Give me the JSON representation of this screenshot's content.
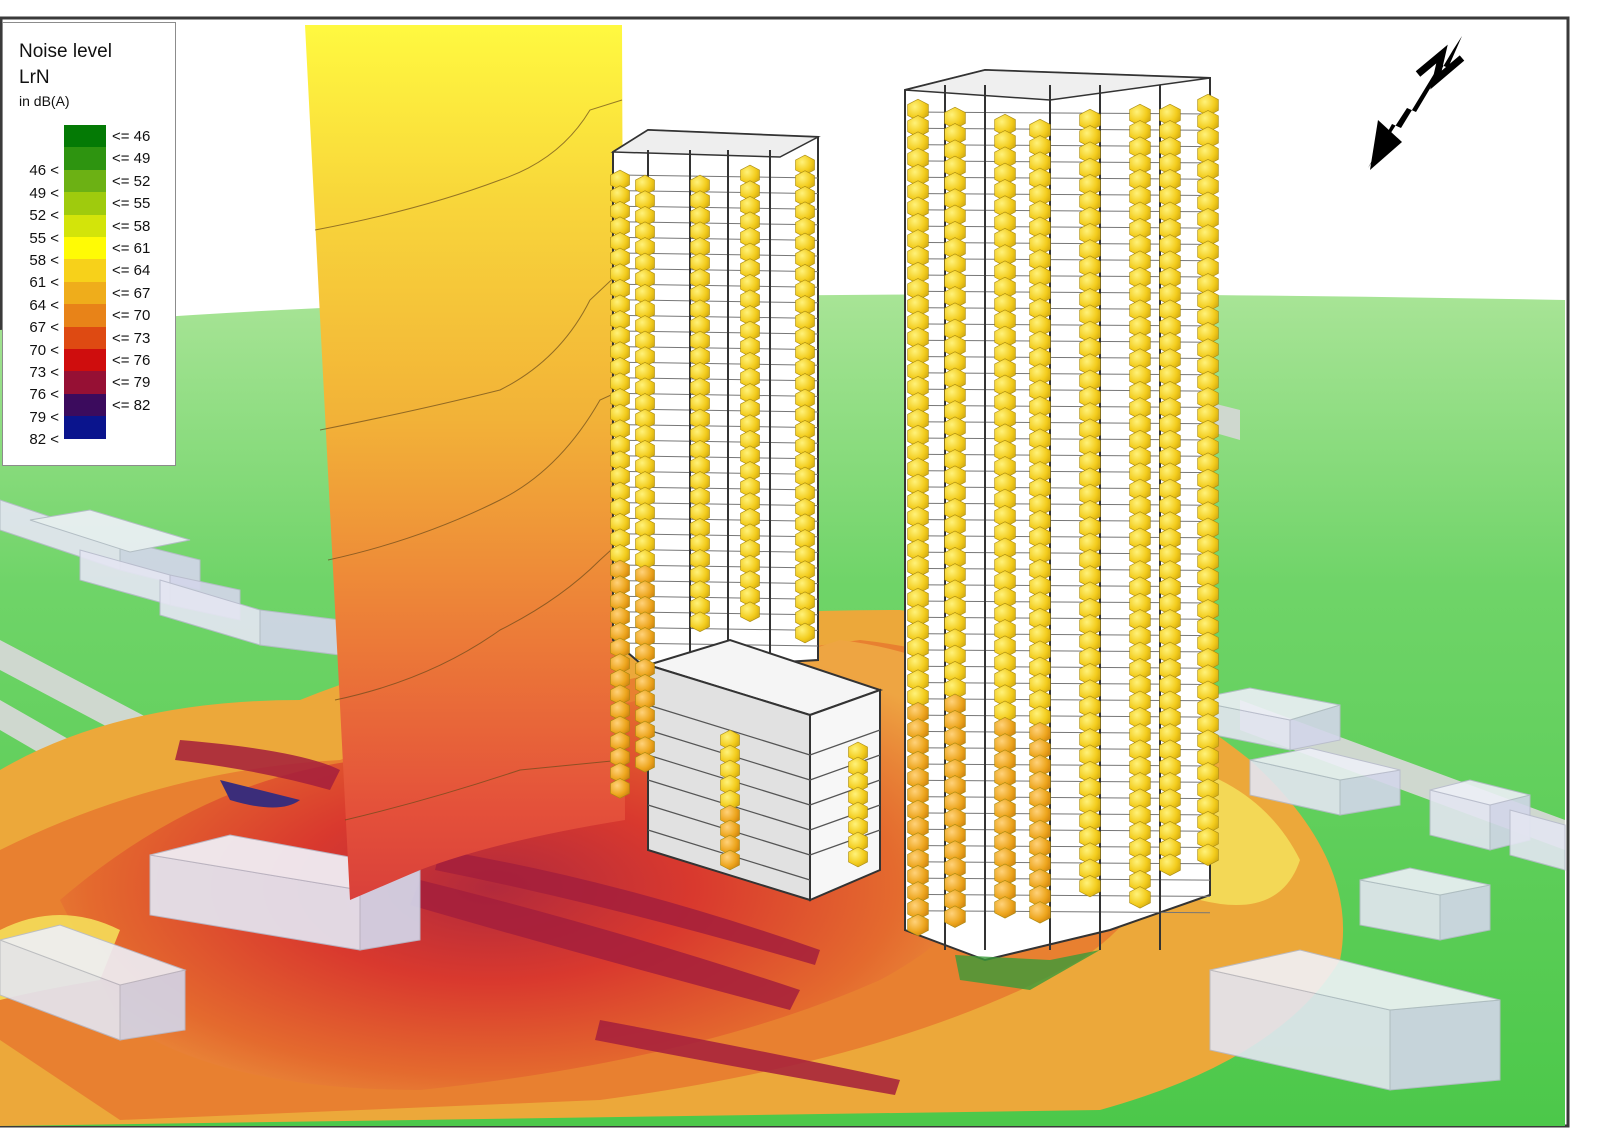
{
  "legend": {
    "title_line1": "Noise level",
    "title_line2": "LrN",
    "unit": "in dB(A)",
    "classes": [
      {
        "low": "",
        "high": "<= 46",
        "color": "#047a05"
      },
      {
        "low": "46 <",
        "high": "<= 49",
        "color": "#2e9410"
      },
      {
        "low": "49 <",
        "high": "<= 52",
        "color": "#6cb114"
      },
      {
        "low": "52 <",
        "high": "<= 55",
        "color": "#9fcb0d"
      },
      {
        "low": "55 <",
        "high": "<= 58",
        "color": "#d3e40a"
      },
      {
        "low": "58 <",
        "high": "<= 61",
        "color": "#fffb05"
      },
      {
        "low": "61 <",
        "high": "<= 64",
        "color": "#f7d11a"
      },
      {
        "low": "64 <",
        "high": "<= 67",
        "color": "#efad1b"
      },
      {
        "low": "67 <",
        "high": "<= 70",
        "color": "#e88318"
      },
      {
        "low": "70 <",
        "high": "<= 73",
        "color": "#de4a12"
      },
      {
        "low": "73 <",
        "high": "<= 76",
        "color": "#cf0d0d"
      },
      {
        "low": "76 <",
        "high": "<= 79",
        "color": "#961034"
      },
      {
        "low": "79 <",
        "high": "<= 82",
        "color": "#3b0b5d"
      },
      {
        "low": "82 <",
        "high": "",
        "color": "#0a148d"
      }
    ]
  },
  "north_arrow": {
    "icon": "north-arrow-icon"
  },
  "colors": {
    "ground": "#62d05e",
    "ground_light": "#9ee08c",
    "building_face": "#ffffff",
    "context_building": "#d3d6ea",
    "receiver_primary": "#f5d01e",
    "receiver_lower": "#efad1b"
  }
}
